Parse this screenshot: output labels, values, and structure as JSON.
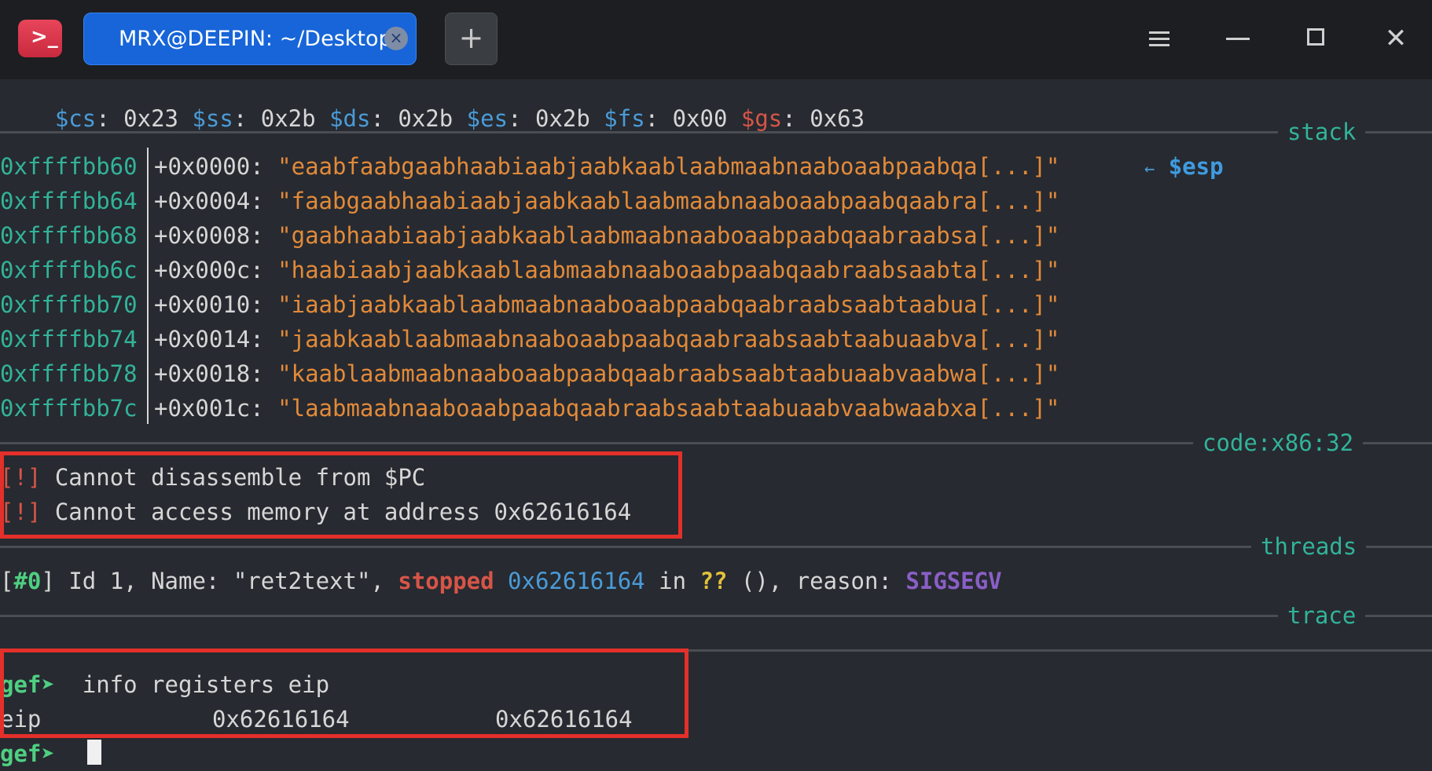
{
  "titlebar": {
    "app_icon": "terminal-icon",
    "app_icon_glyph": ">_",
    "tab_title": "MRX@DEEPIN: ~/Desktop",
    "tab_close_glyph": "×",
    "new_tab_glyph": "+",
    "close_glyph": "✕"
  },
  "segments": {
    "seg_line": [
      {
        "text": "$cs",
        "color": "reg"
      },
      {
        "text": ": 0x23 ",
        "color": "plain"
      },
      {
        "text": "$ss",
        "color": "reg"
      },
      {
        "text": ": 0x2b ",
        "color": "plain"
      },
      {
        "text": "$ds",
        "color": "reg"
      },
      {
        "text": ": 0x2b ",
        "color": "plain"
      },
      {
        "text": "$es",
        "color": "reg"
      },
      {
        "text": ": 0x2b ",
        "color": "plain"
      },
      {
        "text": "$fs",
        "color": "reg"
      },
      {
        "text": ": 0x00 ",
        "color": "plain"
      },
      {
        "text": "$gs",
        "color": "red"
      },
      {
        "text": ": 0x63",
        "color": "plain"
      }
    ]
  },
  "sections": {
    "stack": "stack",
    "code": "code:x86:32",
    "threads": "threads",
    "trace": "trace"
  },
  "stack": {
    "esp_arrow": "←",
    "esp_label": "$esp",
    "rows": [
      {
        "addr": "0xffffbb60",
        "offset": "+0x0000:",
        "value": "\"eaabfaabgaabhaabiaabjaabkaablaabmaabnaaboaabpaabqa[...]\""
      },
      {
        "addr": "0xffffbb64",
        "offset": "+0x0004:",
        "value": "\"faabgaabhaabiaabjaabkaablaabmaabnaaboaabpaabqaabra[...]\""
      },
      {
        "addr": "0xffffbb68",
        "offset": "+0x0008:",
        "value": "\"gaabhaabiaabjaabkaablaabmaabnaaboaabpaabqaabraabsa[...]\""
      },
      {
        "addr": "0xffffbb6c",
        "offset": "+0x000c:",
        "value": "\"haabiaabjaabkaablaabmaabnaaboaabpaabqaabraabsaabta[...]\""
      },
      {
        "addr": "0xffffbb70",
        "offset": "+0x0010:",
        "value": "\"iaabjaabkaablaabmaabnaaboaabpaabqaabraabsaabtaabua[...]\""
      },
      {
        "addr": "0xffffbb74",
        "offset": "+0x0014:",
        "value": "\"jaabkaablaabmaabnaaboaabpaabqaabraabsaabtaabuaabva[...]\""
      },
      {
        "addr": "0xffffbb78",
        "offset": "+0x0018:",
        "value": "\"kaablaabmaabnaaboaabpaabqaabraabsaabtaabuaabvaabwa[...]\""
      },
      {
        "addr": "0xffffbb7c",
        "offset": "+0x001c:",
        "value": "\"laabmaabnaaboaabpaabqaabraabsaabtaabuaabvaabwaabxa[...]\""
      }
    ]
  },
  "code": {
    "errors": [
      {
        "tag": "[!]",
        "text": " Cannot disassemble from $PC"
      },
      {
        "tag": "[!]",
        "text": " Cannot access memory at address 0x62616164"
      }
    ]
  },
  "threads": {
    "bracket_open": "[",
    "thread_num": "#0",
    "bracket_close": "]",
    "part1": " Id 1, Name: \"ret2text\", ",
    "state": "stopped",
    "space1": " ",
    "pc": "0x62616164",
    "part2": " in ",
    "func": "??",
    "part3": " (), reason: ",
    "reason": "SIGSEGV"
  },
  "console": {
    "prompt": "gef➤",
    "command": "  info registers eip",
    "reg_name": "eip",
    "reg_hex": "0x62616164",
    "reg_val": "0x62616164",
    "prompt2": "gef➤"
  }
}
